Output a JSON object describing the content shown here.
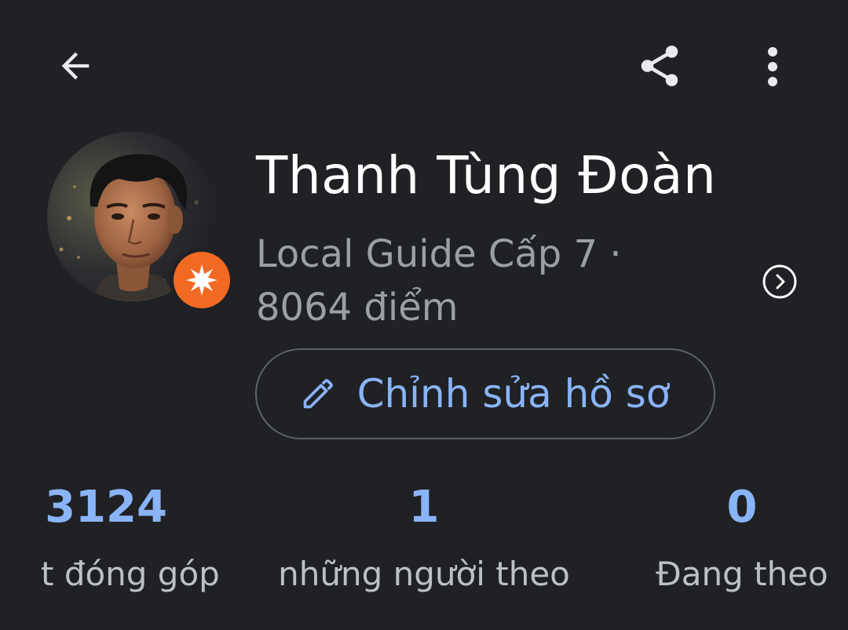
{
  "profile": {
    "name": "Thanh Tùng Đoàn",
    "level_line": "Local Guide Cấp 7 ·",
    "points_line": "8064 điểm"
  },
  "actions": {
    "edit_label": "Chỉnh sửa hồ sơ"
  },
  "stats": [
    {
      "value": "3124",
      "label": "t đóng góp"
    },
    {
      "value": "1",
      "label": "những người theo"
    },
    {
      "value": "0",
      "label": "Đang theo"
    }
  ],
  "icons": {
    "back": "arrow-back-icon",
    "share": "share-icon",
    "more": "more-vert-icon",
    "level_badge": "local-guide-star-icon",
    "chevron": "chevron-right-circle-icon",
    "edit": "pencil-icon"
  },
  "colors": {
    "background": "#202124",
    "accent": "#8ab4f8",
    "badge": "#f26a21",
    "secondary_text": "#9aa0a6"
  }
}
